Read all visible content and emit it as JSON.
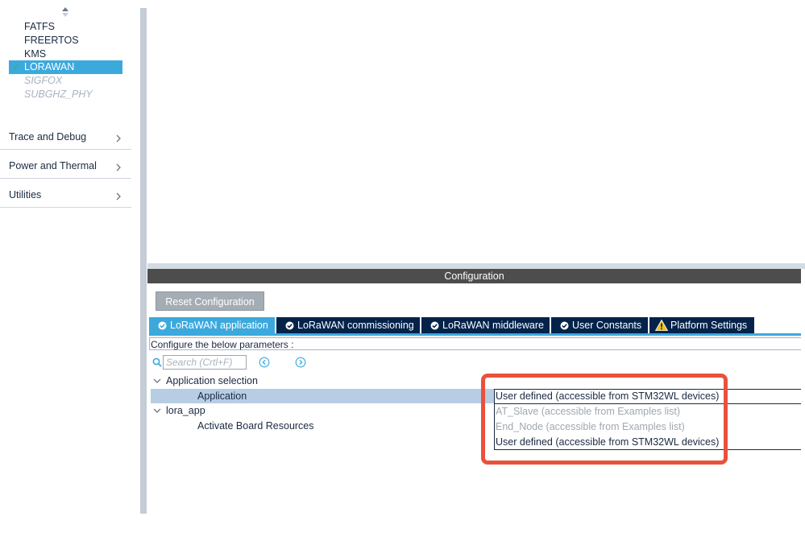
{
  "sidebar": {
    "middleware_items": [
      {
        "label": "FATFS",
        "state": "normal"
      },
      {
        "label": "FREERTOS",
        "state": "normal"
      },
      {
        "label": "KMS",
        "state": "normal"
      },
      {
        "label": "LORAWAN",
        "state": "selected"
      },
      {
        "label": "SIGFOX",
        "state": "disabled"
      },
      {
        "label": "SUBGHZ_PHY",
        "state": "disabled"
      }
    ],
    "categories": [
      {
        "label": "Trace and Debug"
      },
      {
        "label": "Power and Thermal"
      },
      {
        "label": "Utilities"
      }
    ]
  },
  "config": {
    "header": "Configuration",
    "reset_label": "Reset Configuration",
    "tabs": [
      {
        "label": "LoRaWAN application",
        "icon": "check-circle-icon",
        "active": true
      },
      {
        "label": "LoRaWAN commissioning",
        "icon": "check-circle-icon",
        "active": false
      },
      {
        "label": "LoRaWAN middleware",
        "icon": "check-circle-icon",
        "active": false
      },
      {
        "label": "User Constants",
        "icon": "check-circle-icon",
        "active": false
      },
      {
        "label": "Platform Settings",
        "icon": "warning-icon",
        "active": false
      }
    ],
    "hint": "Configure the below parameters :",
    "search_placeholder": "Search (Crtl+F)"
  },
  "tree": {
    "group1": {
      "label": "Application selection"
    },
    "param1": {
      "label": "Application",
      "value": "User defined (accessible from STM32WL devices)"
    },
    "group2": {
      "label": "lora_app"
    },
    "param2": {
      "label": "Activate Board Resources"
    }
  },
  "dropdown": {
    "options": [
      {
        "label": "AT_Slave (accessible from Examples list)",
        "enabled": false
      },
      {
        "label": "End_Node (accessible from Examples list)",
        "enabled": false
      },
      {
        "label": "User defined (accessible from STM32WL devices)",
        "enabled": true
      }
    ]
  },
  "colors": {
    "accent": "#3ca9dd",
    "tab_dark": "#03234b",
    "highlight": "#e9513b",
    "check_green": "#33b36b"
  }
}
